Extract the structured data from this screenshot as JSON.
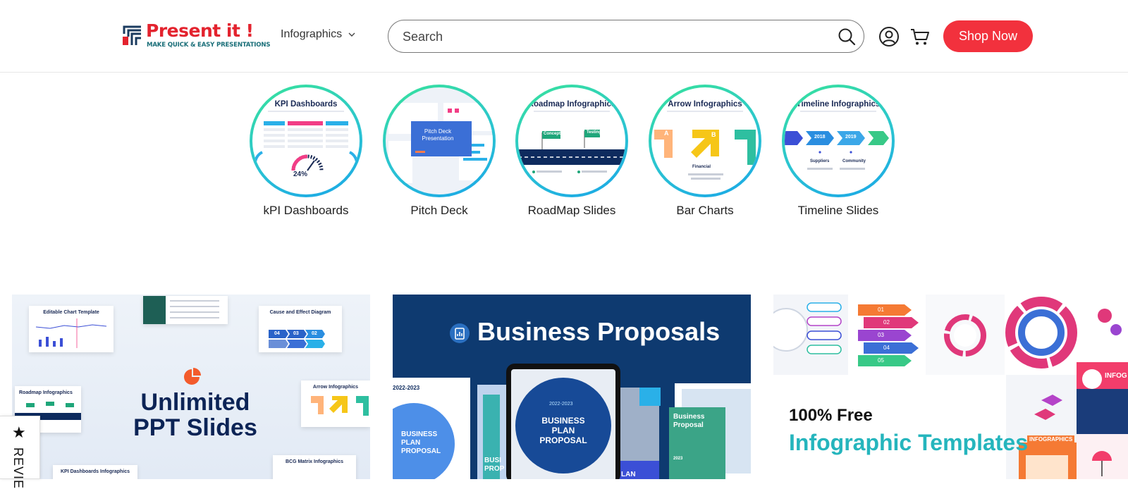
{
  "brand": {
    "name": "Present it !",
    "tagline": "MAKE QUICK & EASY PRESENTATIONS",
    "primary_color": "#e3232e",
    "secondary_color": "#1b6f79"
  },
  "header": {
    "nav_dropdown": "Infographics",
    "search_placeholder": "Search",
    "shop_button": "Shop Now",
    "shop_button_color": "#f2313d",
    "icons": [
      "search-icon",
      "account-icon",
      "cart-icon",
      "chevron-down-icon"
    ]
  },
  "categories": [
    {
      "label": "kPI Dashboards",
      "thumb_title": "KPI Dashboards",
      "thumb_value": "24%"
    },
    {
      "label": "Pitch Deck",
      "thumb_title": "Pitch Deck Presentation"
    },
    {
      "label": "RoadMap Slides",
      "thumb_title": "Roadmap Infographics",
      "thumb_tags": [
        "Concept",
        "Testing"
      ]
    },
    {
      "label": "Bar Charts",
      "thumb_title": "Arrow Infographics",
      "thumb_tags": [
        "A",
        "B",
        "Financial"
      ]
    },
    {
      "label": "Timeline Slides",
      "thumb_title": "Timeline Infographics",
      "thumb_years": [
        "2018",
        "2019"
      ],
      "thumb_tags": [
        "Suppliers",
        "Community"
      ]
    }
  ],
  "banners": [
    {
      "headline": "Unlimited PPT Slides",
      "cards": [
        "Editable Chart Template",
        "Cause and Effect Diagram",
        "Roadmap Infographics",
        "Arrow Infographics",
        "BCG Matrix Infographics",
        "KPI Dashboards Infographics"
      ],
      "steps": [
        "04",
        "03",
        "02"
      ]
    },
    {
      "headline": "Business Proposals",
      "cover_years": "2022-2023",
      "cover_text": "BUSINESS PLAN PROPOSAL",
      "side_cover": "Business Proposal",
      "side_year": "2023",
      "left_cover": "BUSINESS PLAN PROPOSAL",
      "fragments": [
        "BUSI PROP",
        "LAN"
      ]
    },
    {
      "headline_line1": "100% Free",
      "headline_line2": "Infographic Templates",
      "labels": [
        "01",
        "02",
        "03",
        "04",
        "05",
        "INFOGRAPHICS",
        "INFOG"
      ],
      "accent_color": "#25b5bd"
    }
  ],
  "review_tab": {
    "label": "REVIE"
  }
}
